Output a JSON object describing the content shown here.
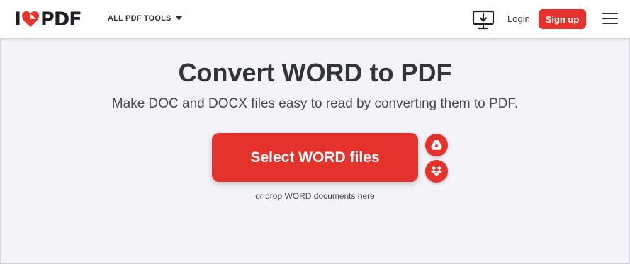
{
  "header": {
    "logo_letter_left": "I",
    "logo_letter_right": "PDF",
    "tools_menu_label": "ALL PDF TOOLS",
    "login_label": "Login",
    "signup_label": "Sign up"
  },
  "main": {
    "title": "Convert WORD to PDF",
    "subtitle": "Make DOC and DOCX files easy to read by converting them to PDF.",
    "select_button_label": "Select WORD files",
    "drop_hint": "or drop WORD documents here"
  },
  "icons": {
    "logo": "heart-icon",
    "tools_caret": "caret-down-icon",
    "desktop": "desktop-download-icon",
    "menu": "hamburger-menu-icon",
    "drive": "google-drive-icon",
    "dropbox": "dropbox-icon"
  },
  "colors": {
    "brand_red": "#e5322d",
    "background": "#f4f3f8",
    "header_bg": "#ffffff",
    "text_dark": "#33333b"
  }
}
